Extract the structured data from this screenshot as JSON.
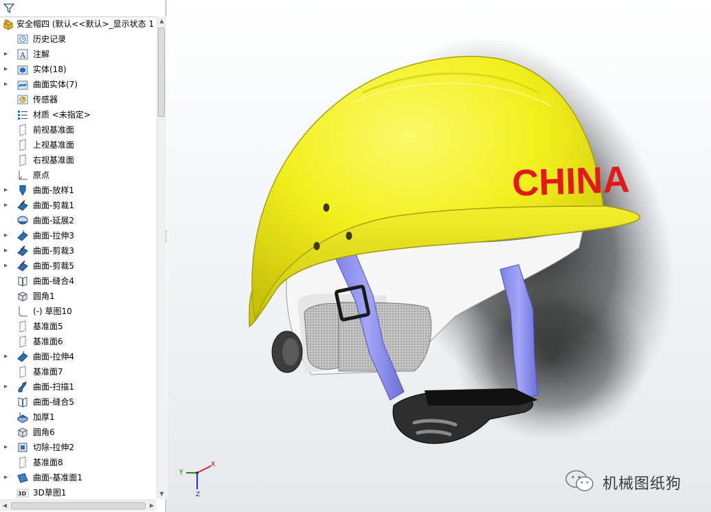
{
  "filter": {
    "icon": "filter-icon"
  },
  "tree": {
    "root": {
      "label": "安全帽四  (默认<<默认>_显示状态 1",
      "icon": "part-icon"
    },
    "items": [
      {
        "label": "历史记录",
        "icon": "history-icon",
        "expandable": false
      },
      {
        "label": "注解",
        "icon": "annotation-icon",
        "expandable": true
      },
      {
        "label": "实体(18)",
        "icon": "solid-bodies-icon",
        "expandable": true
      },
      {
        "label": "曲面实体(7)",
        "icon": "surface-bodies-icon",
        "expandable": true
      },
      {
        "label": "传感器",
        "icon": "sensor-icon",
        "expandable": false
      },
      {
        "label": "材质 <未指定>",
        "icon": "material-icon",
        "expandable": false
      },
      {
        "label": "前视基准面",
        "icon": "plane-icon",
        "expandable": false
      },
      {
        "label": "上视基准面",
        "icon": "plane-icon",
        "expandable": false
      },
      {
        "label": "右视基准面",
        "icon": "plane-icon",
        "expandable": false
      },
      {
        "label": "原点",
        "icon": "origin-icon",
        "expandable": false
      },
      {
        "label": "曲面-放样1",
        "icon": "surface-loft-icon",
        "expandable": true
      },
      {
        "label": "曲面-剪裁1",
        "icon": "surface-trim-icon",
        "expandable": true
      },
      {
        "label": "曲面-延展2",
        "icon": "surface-extend-icon",
        "expandable": false
      },
      {
        "label": "曲面-拉伸3",
        "icon": "surface-extrude-icon",
        "expandable": true
      },
      {
        "label": "曲面-剪裁3",
        "icon": "surface-trim-icon",
        "expandable": true
      },
      {
        "label": "曲面-剪裁5",
        "icon": "surface-trim-icon",
        "expandable": true
      },
      {
        "label": "曲面-缝合4",
        "icon": "surface-knit-icon",
        "expandable": false
      },
      {
        "label": "圆角1",
        "icon": "fillet-icon",
        "expandable": false
      },
      {
        "label": "(-) 草图10",
        "icon": "sketch-icon",
        "expandable": false
      },
      {
        "label": "基准面5",
        "icon": "plane-icon",
        "expandable": false
      },
      {
        "label": "基准面6",
        "icon": "plane-icon",
        "expandable": false
      },
      {
        "label": "曲面-拉伸4",
        "icon": "surface-extrude-icon",
        "expandable": true
      },
      {
        "label": "基准面7",
        "icon": "plane-icon",
        "expandable": false
      },
      {
        "label": "曲面-扫描1",
        "icon": "surface-sweep-icon",
        "expandable": true
      },
      {
        "label": "曲面-缝合5",
        "icon": "surface-knit-icon",
        "expandable": false
      },
      {
        "label": "加厚1",
        "icon": "thicken-icon",
        "expandable": false
      },
      {
        "label": "圆角6",
        "icon": "fillet-icon",
        "expandable": false
      },
      {
        "label": "切除-拉伸2",
        "icon": "cut-extrude-icon",
        "expandable": true
      },
      {
        "label": "基准面8",
        "icon": "plane-icon",
        "expandable": false
      },
      {
        "label": "曲面-基准面1",
        "icon": "planar-surface-icon",
        "expandable": true
      },
      {
        "label": "3D草图1",
        "icon": "sketch-3d-icon",
        "expandable": false
      }
    ]
  },
  "model": {
    "helmet_text": "CHINA",
    "shell_color": "#f2ef1e",
    "text_color": "#e01a1a",
    "strap_color": "#8f92f0"
  },
  "triad": {
    "x": "X",
    "y": "Y",
    "z": "Z"
  },
  "watermark": {
    "text": "机械图纸狗",
    "icon": "wechat-icon"
  },
  "colors": {
    "panel_bg": "#ffffff",
    "icon_blue": "#2f6db5",
    "icon_yellow": "#e8b52a"
  }
}
